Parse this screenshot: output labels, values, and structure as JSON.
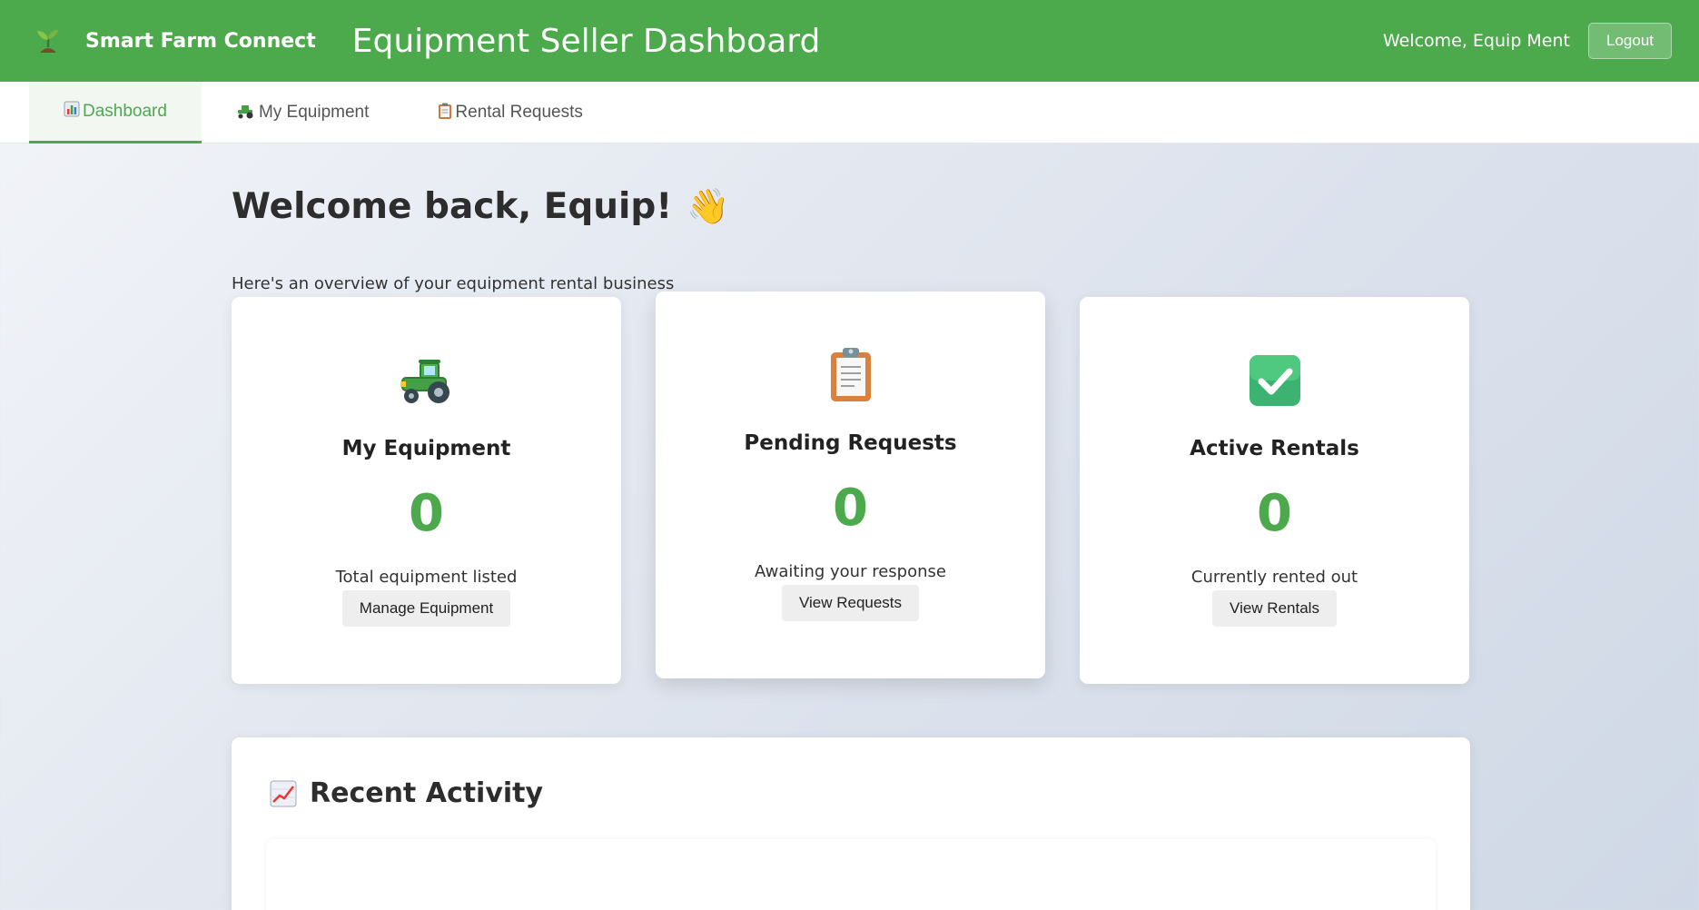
{
  "header": {
    "brand_name": "Smart Farm Connect",
    "brand_icon": "seedling-icon",
    "page_title": "Equipment Seller Dashboard",
    "welcome_user": "Welcome, Equip Ment",
    "logout_label": "Logout",
    "accent_color": "#4caa4c"
  },
  "tabs": [
    {
      "label": "Dashboard",
      "icon": "bar-chart-icon",
      "active": true
    },
    {
      "label": "My Equipment",
      "icon": "tractor-icon",
      "active": false
    },
    {
      "label": "Rental Requests",
      "icon": "clipboard-icon",
      "active": false
    }
  ],
  "main": {
    "welcome_heading": "Welcome back, Equip!",
    "welcome_emoji": "👋",
    "subtitle": "Here's an overview of your equipment rental business"
  },
  "cards": [
    {
      "icon": "tractor-icon",
      "title": "My Equipment",
      "value": "0",
      "description": "Total equipment listed",
      "button": "Manage Equipment"
    },
    {
      "icon": "clipboard-icon",
      "title": "Pending Requests",
      "value": "0",
      "description": "Awaiting your response",
      "button": "View Requests"
    },
    {
      "icon": "check-mark-icon",
      "title": "Active Rentals",
      "value": "0",
      "description": "Currently rented out",
      "button": "View Rentals"
    }
  ],
  "activity": {
    "title": "Recent Activity",
    "icon": "trend-chart-icon"
  }
}
